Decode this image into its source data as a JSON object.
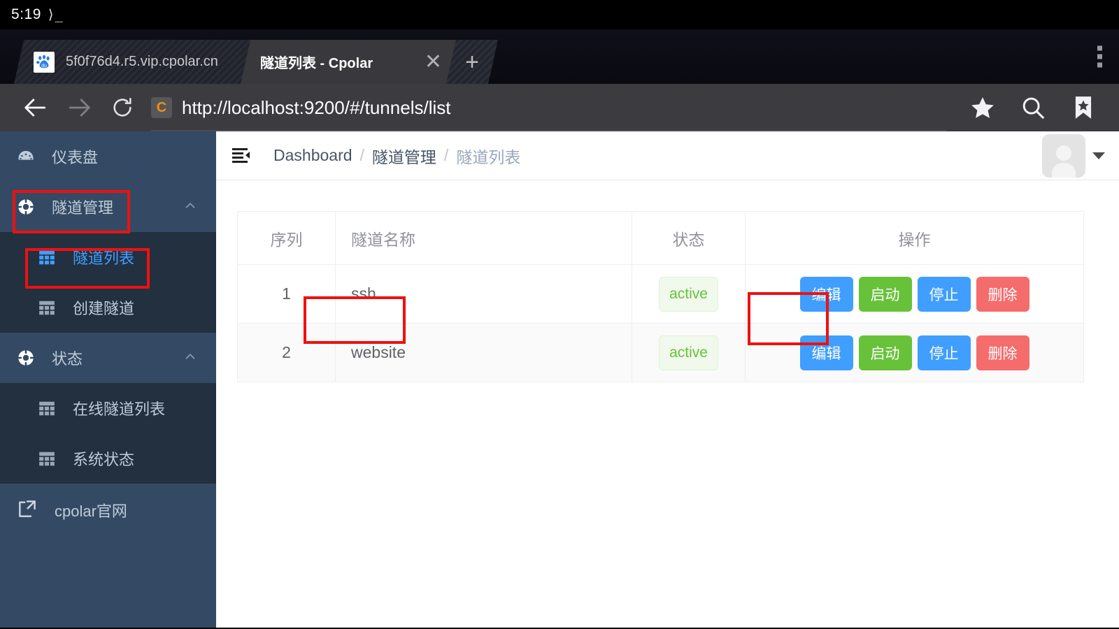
{
  "statusbar": {
    "clock": "5:19",
    "terminal_icon": "terminal-prompt-icon"
  },
  "browser": {
    "tabs": [
      {
        "title": "5f0f76d4.r5.vip.cpolar.cn",
        "favicon": "baidu-favicon",
        "active": false
      },
      {
        "title": "隧道列表 - Cpolar",
        "favicon": "",
        "active": true
      }
    ],
    "close_label": "✕",
    "new_tab_label": "+",
    "url": "http://localhost:9200/#/tunnels/list",
    "site_chip_letter": "C",
    "icons": {
      "back": "back-arrow-icon",
      "forward": "forward-arrow-icon",
      "reload": "reload-icon",
      "star": "star-icon",
      "search": "search-icon",
      "bookmarks": "bookmarks-icon",
      "menu": "kebab-menu-icon"
    }
  },
  "sidebar": {
    "items": [
      {
        "label": "仪表盘",
        "icon": "dashboard-gauge-icon",
        "type": "item",
        "active": false
      },
      {
        "label": "隧道管理",
        "icon": "lifebuoy-icon",
        "type": "group",
        "caret": "chevron-up-icon",
        "active": false
      },
      {
        "label": "隧道列表",
        "icon": "grid-table-icon",
        "type": "sub",
        "active": true
      },
      {
        "label": "创建隧道",
        "icon": "grid-table-icon",
        "type": "sub",
        "active": false
      },
      {
        "label": "状态",
        "icon": "lifebuoy-icon",
        "type": "group",
        "caret": "chevron-up-icon",
        "active": false
      },
      {
        "label": "在线隧道列表",
        "icon": "grid-table-icon",
        "type": "sub",
        "active": false
      },
      {
        "label": "系统状态",
        "icon": "grid-table-icon",
        "type": "sub",
        "active": false
      }
    ],
    "external": {
      "label": "cpolar官网",
      "icon": "external-link-icon"
    }
  },
  "topbar": {
    "fold_icon": "fold-menu-icon",
    "breadcrumb": [
      {
        "label": "Dashboard",
        "current": false
      },
      {
        "label": "隧道管理",
        "current": false
      },
      {
        "label": "隧道列表",
        "current": true
      }
    ],
    "separator": "/",
    "avatar": "user-avatar-icon",
    "caret": "chevron-down-icon"
  },
  "table": {
    "columns": [
      {
        "key": "idx",
        "label": "序列",
        "align": "center"
      },
      {
        "key": "name",
        "label": "隧道名称",
        "align": "left"
      },
      {
        "key": "state",
        "label": "状态",
        "align": "center"
      },
      {
        "key": "ops",
        "label": "操作",
        "align": "center"
      }
    ],
    "rows": [
      {
        "idx": "1",
        "name": "ssh",
        "state": "active"
      },
      {
        "idx": "2",
        "name": "website",
        "state": "active"
      }
    ],
    "buttons": [
      {
        "label": "编辑",
        "style": "btn-primary",
        "name": "edit-button"
      },
      {
        "label": "启动",
        "style": "btn-success",
        "name": "start-button"
      },
      {
        "label": "停止",
        "style": "btn-primary",
        "name": "stop-button"
      },
      {
        "label": "删除",
        "style": "btn-danger",
        "name": "delete-button"
      }
    ]
  },
  "colors": {
    "accent_blue": "#409eff",
    "success_green": "#67c23a",
    "danger_red": "#f56c6c",
    "sidebar_bg": "#344a64",
    "submenu_bg": "#22303f",
    "highlight_box": "#ee1111"
  }
}
